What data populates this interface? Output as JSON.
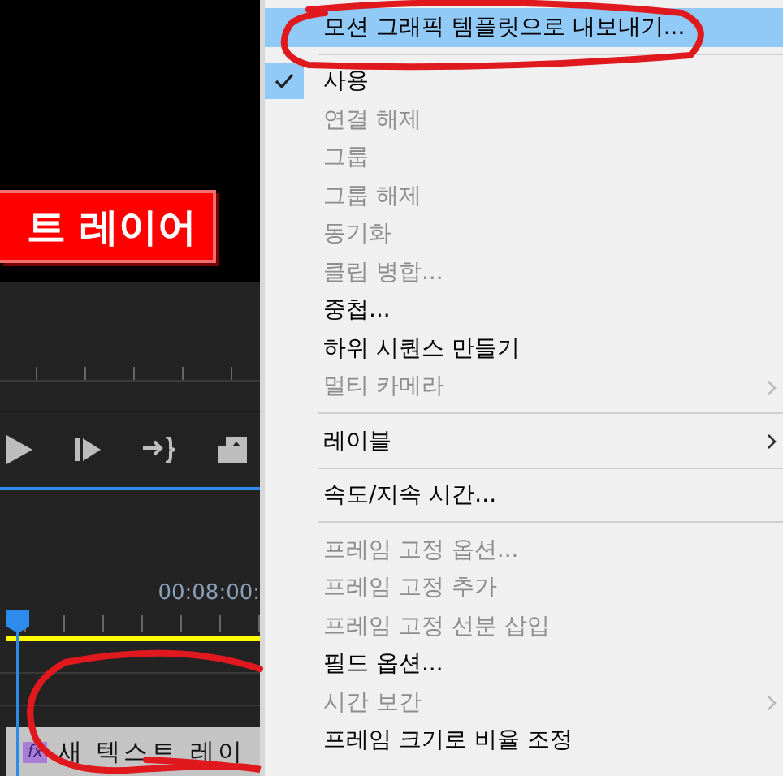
{
  "monitor": {
    "title_overlay": "트 레이어"
  },
  "transport": [
    {
      "kind": "play"
    },
    {
      "kind": "step-forward"
    },
    {
      "kind": "insert"
    },
    {
      "kind": "export-frame"
    }
  ],
  "timeline": {
    "timecode": "00:08:00:",
    "clip": {
      "label": "새 텍스트 레이",
      "effect_badge": "fx"
    }
  },
  "context_menu": [
    {
      "kind": "item",
      "label": "모션 그래픽 템플릿으로 내보내기...",
      "selected": true,
      "checked": false,
      "disabled": false,
      "submenu": false
    },
    {
      "kind": "separator"
    },
    {
      "kind": "item",
      "label": "사용",
      "selected": false,
      "checked": true,
      "disabled": false,
      "submenu": false
    },
    {
      "kind": "item",
      "label": "연결 해제",
      "selected": false,
      "checked": false,
      "disabled": true,
      "submenu": false
    },
    {
      "kind": "item",
      "label": "그룹",
      "selected": false,
      "checked": false,
      "disabled": true,
      "submenu": false
    },
    {
      "kind": "item",
      "label": "그룹 해제",
      "selected": false,
      "checked": false,
      "disabled": true,
      "submenu": false
    },
    {
      "kind": "item",
      "label": "동기화",
      "selected": false,
      "checked": false,
      "disabled": true,
      "submenu": false
    },
    {
      "kind": "item",
      "label": "클립 병합...",
      "selected": false,
      "checked": false,
      "disabled": true,
      "submenu": false
    },
    {
      "kind": "item",
      "label": "중첩...",
      "selected": false,
      "checked": false,
      "disabled": false,
      "submenu": false
    },
    {
      "kind": "item",
      "label": "하위 시퀀스 만들기",
      "selected": false,
      "checked": false,
      "disabled": false,
      "submenu": false
    },
    {
      "kind": "item",
      "label": "멀티 카메라",
      "selected": false,
      "checked": false,
      "disabled": true,
      "submenu": true
    },
    {
      "kind": "separator"
    },
    {
      "kind": "item",
      "label": "레이블",
      "selected": false,
      "checked": false,
      "disabled": false,
      "submenu": true
    },
    {
      "kind": "separator"
    },
    {
      "kind": "item",
      "label": "속도/지속 시간...",
      "selected": false,
      "checked": false,
      "disabled": false,
      "submenu": false
    },
    {
      "kind": "separator"
    },
    {
      "kind": "item",
      "label": "프레임 고정 옵션...",
      "selected": false,
      "checked": false,
      "disabled": true,
      "submenu": false
    },
    {
      "kind": "item",
      "label": "프레임 고정 추가",
      "selected": false,
      "checked": false,
      "disabled": true,
      "submenu": false
    },
    {
      "kind": "item",
      "label": "프레임 고정 선분 삽입",
      "selected": false,
      "checked": false,
      "disabled": true,
      "submenu": false
    },
    {
      "kind": "item",
      "label": "필드 옵션...",
      "selected": false,
      "checked": false,
      "disabled": false,
      "submenu": false
    },
    {
      "kind": "item",
      "label": "시간 보간",
      "selected": false,
      "checked": false,
      "disabled": true,
      "submenu": true
    },
    {
      "kind": "item",
      "label": "프레임 크기로 비율 조정",
      "selected": false,
      "checked": false,
      "disabled": false,
      "submenu": false
    }
  ],
  "annotations": [
    {
      "kind": "ellipse"
    },
    {
      "kind": "ellipse"
    }
  ]
}
